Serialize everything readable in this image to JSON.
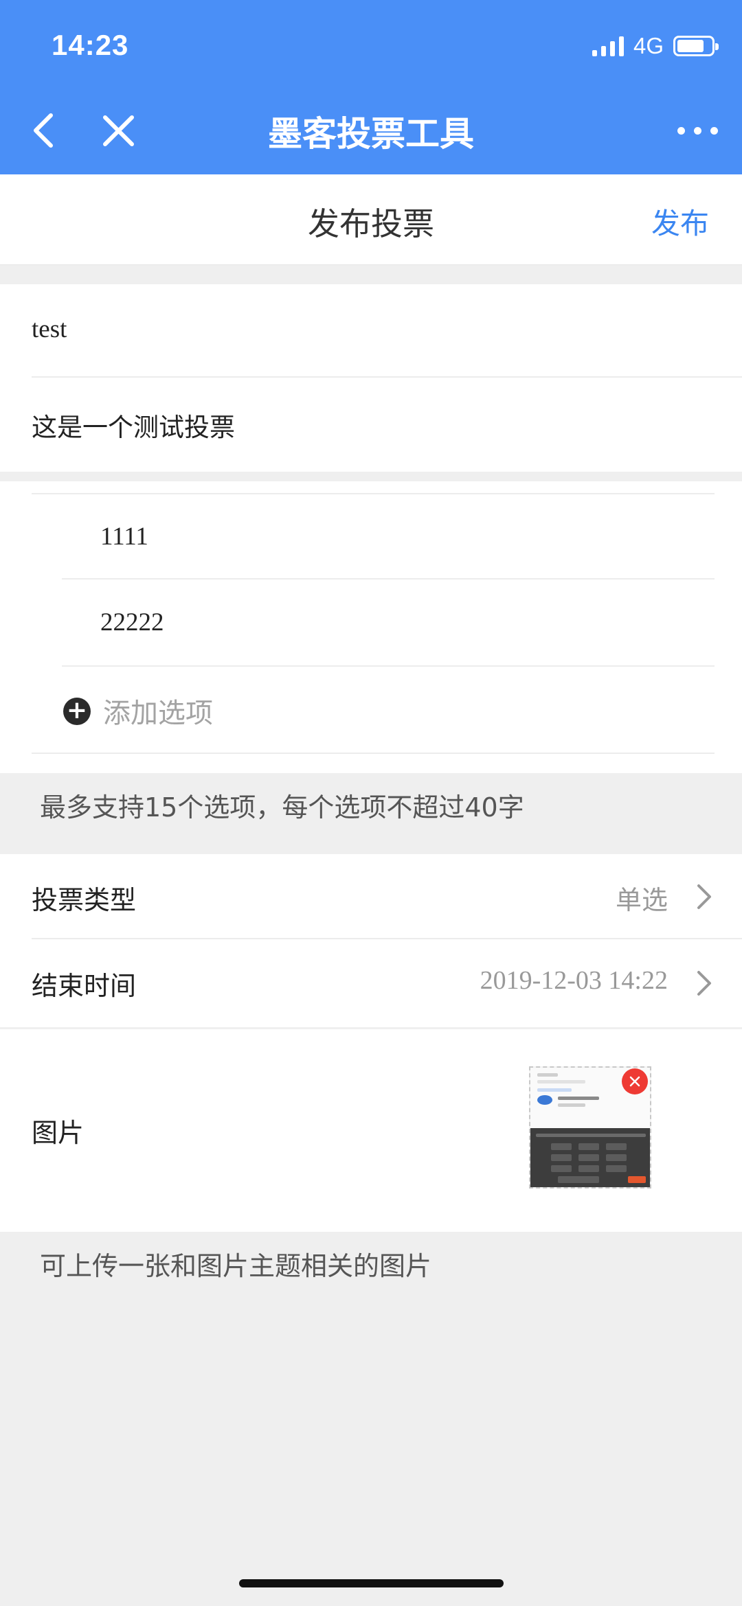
{
  "status_bar": {
    "time": "14:23",
    "network": "4G"
  },
  "nav": {
    "title": "墨客投票工具",
    "icons": {
      "back": "chevron-left-icon",
      "close": "close-icon",
      "more": "more-horizontal-icon"
    }
  },
  "header": {
    "title": "发布投票",
    "publish_label": "发布"
  },
  "form": {
    "title_value": "test",
    "description_value": "这是一个测试投票",
    "options": [
      "1111",
      "22222"
    ],
    "add_option_label": "添加选项",
    "options_hint": "最多支持15个选项，每个选项不超过40字",
    "vote_type": {
      "label": "投票类型",
      "value": "单选"
    },
    "end_time": {
      "label": "结束时间",
      "value": "2019-12-03 14:22"
    },
    "image": {
      "label": "图片"
    },
    "image_hint": "可上传一张和图片主题相关的图片"
  },
  "colors": {
    "brand": "#4a8ff7",
    "link": "#3b86f1",
    "delete": "#ee3a34",
    "background": "#efefef"
  }
}
